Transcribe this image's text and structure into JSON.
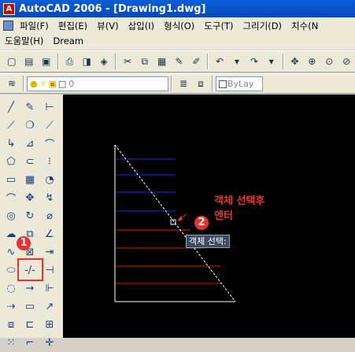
{
  "window": {
    "title": "AutoCAD 2006 - [Drawing1.dwg]"
  },
  "menu": {
    "row1": [
      "파일(F)",
      "편집(E)",
      "뷰(V)",
      "삽입(I)",
      "형식(O)",
      "도구(T)",
      "그리기(D)",
      "치수(N"
    ],
    "row2": [
      "도움말(H)",
      "Dream"
    ]
  },
  "toolbar": {
    "layer_value": "0",
    "color_value": "ByLay"
  },
  "annotations": {
    "callout1": "1",
    "callout2": "2",
    "instruction_line1": "객체 선택후",
    "instruction_line2": "엔터",
    "tooltip": "객체 선택:"
  },
  "colors": {
    "blue_lines": "#1a2bd6",
    "red_lines": "#d81a1a",
    "accent": "#e8332f"
  }
}
